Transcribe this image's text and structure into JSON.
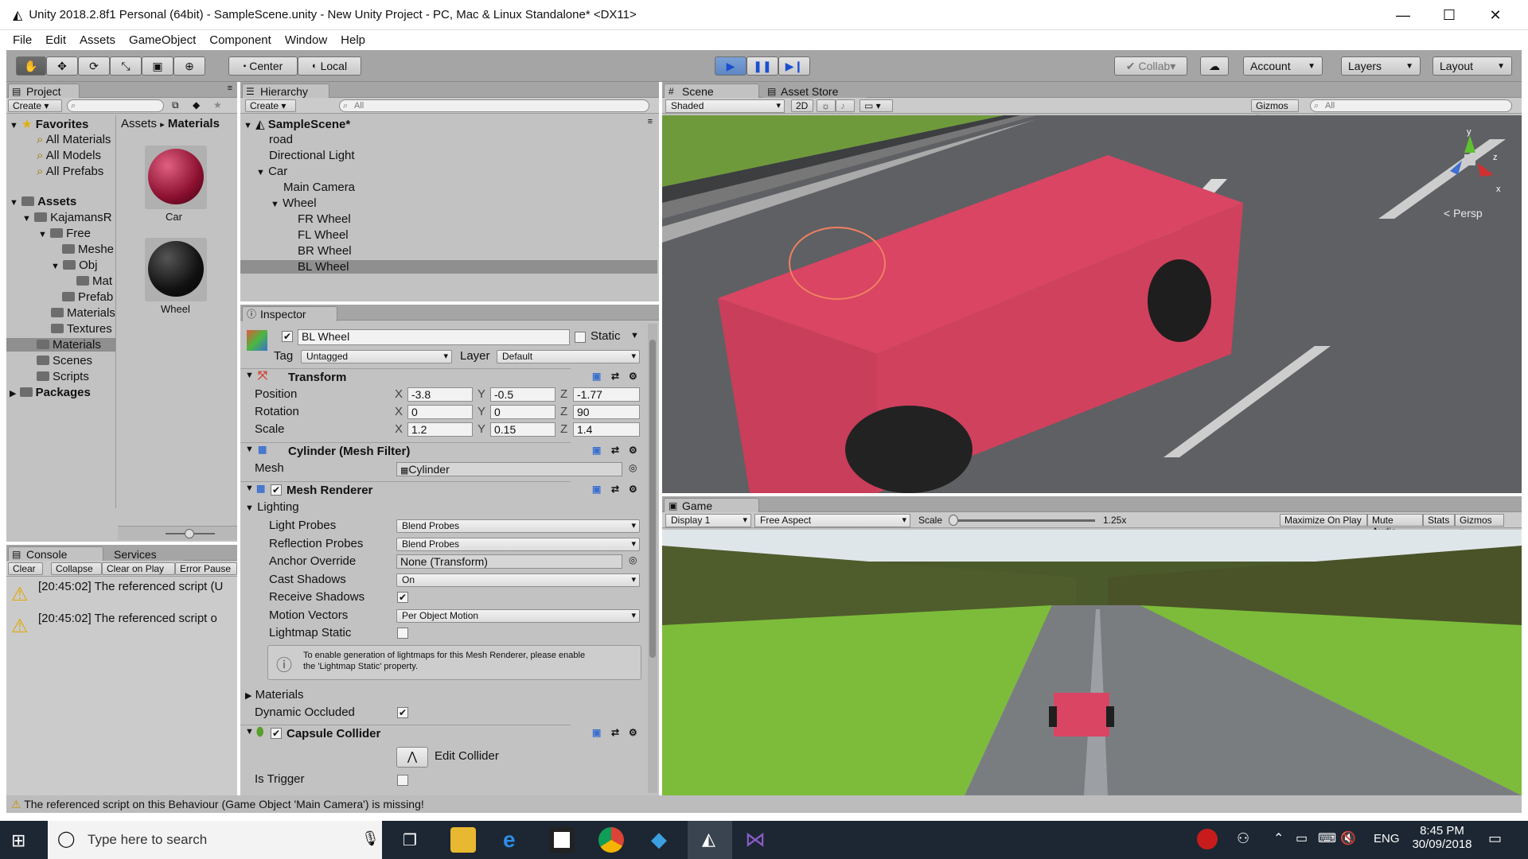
{
  "window": {
    "title": "Unity 2018.2.8f1 Personal (64bit) - SampleScene.unity - New Unity Project - PC, Mac & Linux Standalone* <DX11>"
  },
  "menu": [
    "File",
    "Edit",
    "Assets",
    "GameObject",
    "Component",
    "Window",
    "Help"
  ],
  "toolbar": {
    "center": "Center",
    "local": "Local",
    "collab": "Collab",
    "account": "Account",
    "layers": "Layers",
    "layout": "Layout"
  },
  "project": {
    "tab": "Project",
    "create": "Create",
    "favorites": "Favorites",
    "fav_items": [
      "All Materials",
      "All Models",
      "All Prefabs"
    ],
    "assets": "Assets",
    "tree": [
      "KajamansR",
      "Free",
      "Meshe",
      "Obj",
      "Mat",
      "Prefab",
      "Materials",
      "Textures",
      "Materials",
      "Scenes",
      "Scripts"
    ],
    "packages": "Packages",
    "breadcrumb": [
      "Assets",
      "Materials"
    ],
    "materials": [
      "Car",
      "Wheel"
    ]
  },
  "console": {
    "tab": "Console",
    "services": "Services",
    "buttons": [
      "Clear",
      "Collapse",
      "Clear on Play",
      "Error Pause"
    ],
    "logs": [
      "[20:45:02] The referenced script (U",
      "[20:45:02] The referenced script o"
    ]
  },
  "hierarchy": {
    "tab": "Hierarchy",
    "create": "Create",
    "search": "All",
    "scene": "SampleScene*",
    "items": [
      "road",
      "Directional Light",
      "Car",
      "Main Camera",
      "Wheel",
      "FR Wheel",
      "FL Wheel",
      "BR Wheel",
      "BL Wheel"
    ]
  },
  "inspector": {
    "tab": "Inspector",
    "name": "BL Wheel",
    "static": "Static",
    "tag_label": "Tag",
    "tag": "Untagged",
    "layer_label": "Layer",
    "layer": "Default",
    "transform": {
      "title": "Transform",
      "position": "Position",
      "rotation": "Rotation",
      "scale": "Scale",
      "pos": [
        "-3.8",
        "-0.5",
        "-1.77"
      ],
      "rot": [
        "0",
        "0",
        "90"
      ],
      "scl": [
        "1.2",
        "0.15",
        "1.4"
      ]
    },
    "axes": [
      "X",
      "Y",
      "Z"
    ],
    "meshfilter": {
      "title": "Cylinder (Mesh Filter)",
      "mesh_label": "Mesh",
      "mesh": "Cylinder"
    },
    "renderer": {
      "title": "Mesh Renderer",
      "lighting": "Lighting",
      "rows": [
        "Light Probes",
        "Reflection Probes",
        "Anchor Override",
        "Cast Shadows",
        "Receive Shadows",
        "Motion Vectors",
        "Lightmap Static"
      ],
      "light_probes": "Blend Probes",
      "reflection_probes": "Blend Probes",
      "anchor": "None (Transform)",
      "cast_shadows": "On",
      "motion_vectors": "Per Object Motion",
      "info1": "To enable generation of lightmaps for this Mesh Renderer, please enable",
      "info2": "the 'Lightmap Static' property.",
      "materials": "Materials",
      "dynamic_occluded": "Dynamic Occluded"
    },
    "collider": {
      "title": "Capsule Collider",
      "edit": "Edit Collider",
      "trigger": "Is Trigger"
    }
  },
  "scene": {
    "tab": "Scene",
    "asset_store": "Asset Store",
    "shaded": "Shaded",
    "mode2d": "2D",
    "gizmos": "Gizmos",
    "search": "All",
    "persp": "< Persp",
    "axis_y": "y",
    "axis_z": "z",
    "axis_x": "x"
  },
  "game": {
    "tab": "Game",
    "display": "Display 1",
    "aspect": "Free Aspect",
    "scale_label": "Scale",
    "scale": "1.25x",
    "buttons": [
      "Maximize On Play",
      "Mute Audio",
      "Stats",
      "Gizmos"
    ]
  },
  "status": "The referenced script on this Behaviour (Game Object 'Main Camera') is missing!",
  "taskbar": {
    "search": "Type here to search",
    "lang": "ENG",
    "time": "8:45 PM",
    "date": "30/09/2018"
  },
  "colors": {
    "car": "#d94563",
    "panel": "#c2c2c2",
    "toolbar": "#a5a5a5",
    "selection": "#8f8f8f"
  }
}
